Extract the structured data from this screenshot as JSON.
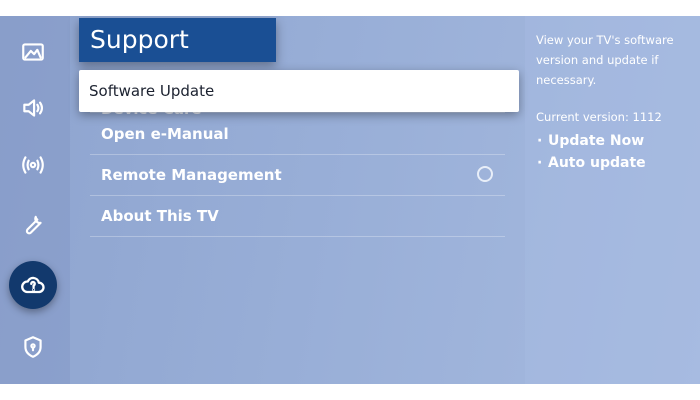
{
  "header": {
    "title": "Support"
  },
  "menu": {
    "focused_item": "Software Update",
    "items": [
      {
        "label": "Device Care"
      },
      {
        "label": "Open e-Manual"
      },
      {
        "label": "Remote Management"
      },
      {
        "label": "About This TV"
      }
    ]
  },
  "rail": {
    "icons": [
      "picture-icon",
      "sound-icon",
      "broadcast-icon",
      "wrench-icon",
      "support-cloud-icon",
      "shield-icon"
    ],
    "selected": "support-cloud-icon"
  },
  "info_panel": {
    "description": "View your TV's software version and update if necessary.",
    "version_text": "Current version: 1112",
    "options": [
      {
        "bullet": "·",
        "label": "Update Now"
      },
      {
        "bullet": "·",
        "label": "Auto update"
      }
    ]
  },
  "colors": {
    "selected_rail": "#12396d",
    "title_box": "#1a4f94",
    "focus_bg": "#ffffff"
  }
}
